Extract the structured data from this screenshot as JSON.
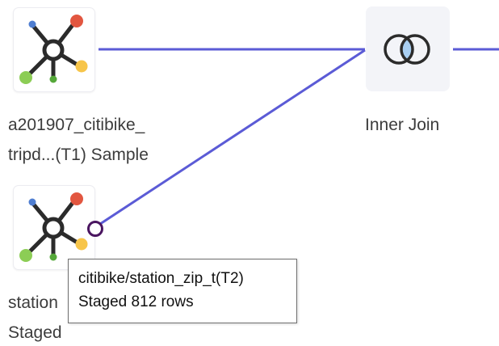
{
  "nodes": {
    "t1": {
      "name_line1": "a201907_citibike_",
      "name_line2": "tripd...(T1) Sample",
      "icon": "dataset-network-icon"
    },
    "t2": {
      "name_line1": "station",
      "name_line2": "Staged",
      "icon": "dataset-network-icon"
    },
    "join": {
      "label": "Inner Join",
      "icon": "inner-join-venn-icon"
    }
  },
  "tooltip": {
    "line1": "citibike/station_zip_t(T2)",
    "line2": "Staged 812 rows"
  },
  "colors": {
    "link": "#5b5bd6",
    "port_border": "#4a1560",
    "join_fill": "#a9cff2",
    "icon_red": "#e25640",
    "icon_blue": "#4f7ed1",
    "icon_green": "#8ccd55",
    "icon_yellow": "#f7c54a",
    "icon_dark_green": "#55a83a"
  }
}
